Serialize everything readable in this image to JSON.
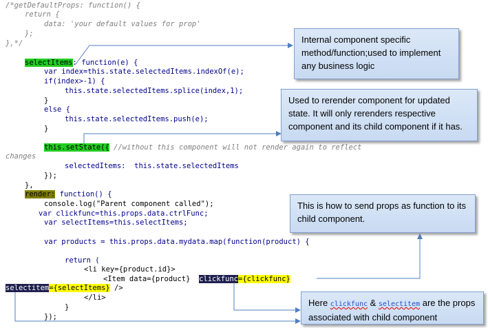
{
  "code": {
    "l1_comment": "/*getDefaultProps: function() {",
    "l2": "return {",
    "l3": "data: 'your default values for prop'",
    "l4": "};",
    "l5": "},*/",
    "l6_method": "selectItems",
    "l6_rest": ": function(e) {",
    "l7": "var index=this.state.selectedItems.indexOf(e);",
    "l8": "if(index>-1) {",
    "l9": "this.state.selectedItems.splice(index,1);",
    "l10": "}",
    "l11": "else {",
    "l12": "this.state.selectedItems.push(e);",
    "l13": "}",
    "l14_setstate": "this.setState({",
    "l14_comment": " //without this component will not render again to reflect",
    "l15": "changes",
    "l16": "selectedItems:  this.state.selectedItems",
    "l17": "});",
    "l18": "},",
    "l19_render": "render:",
    "l19_rest": " function() {",
    "l20": "console.log(\"Parent component called\");",
    "l21": "var clickfunc=this.props.data.ctrlFunc;",
    "l22": "var selectItems=this.selectItems;",
    "l23": "var products = this.props.data.mydata.map(function(product) {",
    "l24": "return (",
    "l25": "<li key={product.id}>",
    "l26_pre": "<Item data={product}",
    "l26_attr": "clickfunc",
    "l26_val": "={clickfunc}",
    "l27_attr": "selectitem",
    "l27_val": "={selectItems}",
    "l27_end": " />",
    "l28": "</li>",
    "l29": "}",
    "l30": "});"
  },
  "callouts": {
    "c1": "Internal component specific method/function;used to implement any business logic",
    "c2": "Used to rerender  component for updated state. It will only rerenders respective component and its child component if it has.",
    "c3": "This is how to send props as function to its child component.",
    "c4_pre": "Here ",
    "c4_a": "clickfunc",
    "c4_amp": " & ",
    "c4_b": "selectitem",
    "c4_post": " are the props associated with child component"
  }
}
